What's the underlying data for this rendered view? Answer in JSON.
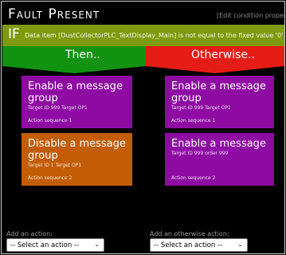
{
  "header": {
    "title": "Fault Present",
    "edit_link": "[Edit condition properties"
  },
  "condition": {
    "keyword": "IF",
    "text": "Data item [DustCollectorPLC_TextDisplay_Main] is not equal to the fixed value '0'"
  },
  "branches": {
    "then_label": "Then..",
    "otherwise_label": "Otherwise.."
  },
  "then_actions": [
    {
      "title": "Enable a message group",
      "target": "Target ID 999 Target OP1",
      "sequence": "Action sequence 1",
      "color": "#8e0aa3"
    },
    {
      "title": "Disable a message group",
      "target": "Target ID 1 Target OP1",
      "sequence": "Action sequence 2",
      "color": "#c25d06"
    }
  ],
  "otherwise_actions": [
    {
      "title": "Enable a message group",
      "target": "Target ID 999 Target OP1",
      "sequence": "Action sequence 1",
      "color": "#8e0aa3"
    },
    {
      "title": "Enable a message",
      "target": "Target ID 999 order 999",
      "sequence": "Action sequence 2",
      "color": "#8e0aa3"
    }
  ],
  "add_action": {
    "label": "Add an action:",
    "select_value": "-- Select an action --"
  },
  "add_otherwise_action": {
    "label": "Add an otherwise action:",
    "select_value": "-- Select an action --"
  },
  "colors": {
    "condition_bar": "#7f9a0f",
    "then_bar": "#119211",
    "otherwise_bar": "#e61c16"
  }
}
